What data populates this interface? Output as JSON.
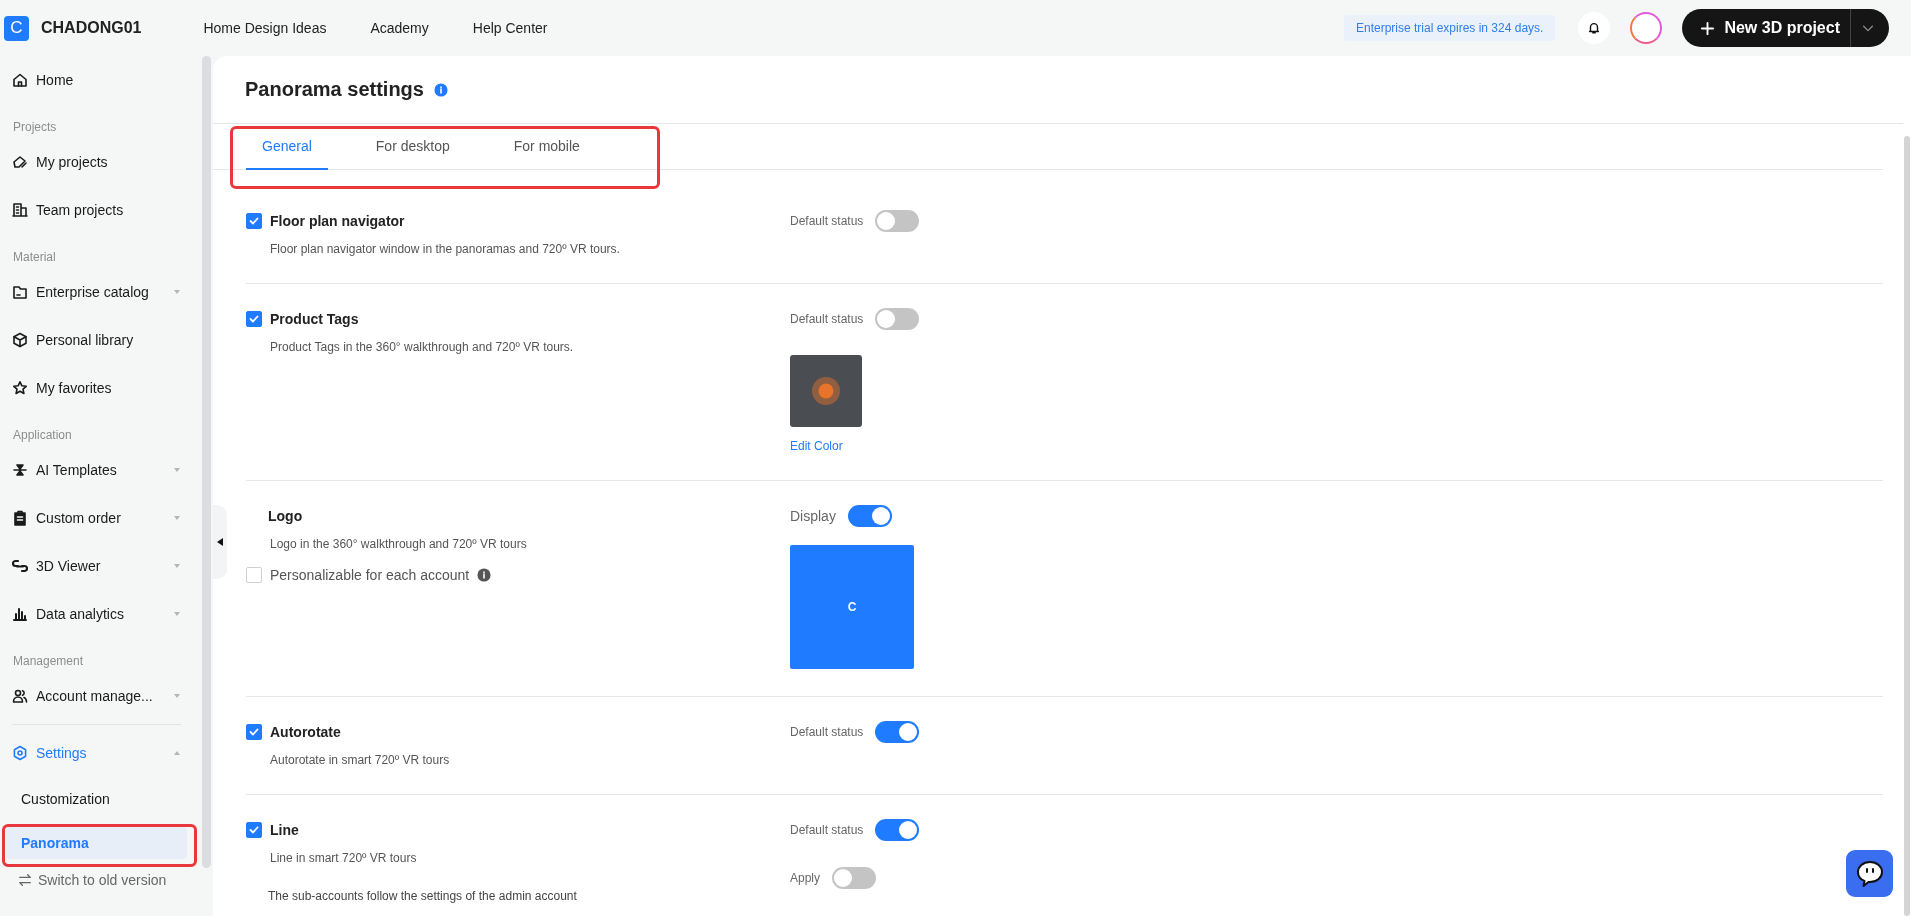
{
  "app": {
    "logo_letter": "C",
    "name": "CHADONG01"
  },
  "top_nav": [
    "Home Design Ideas",
    "Academy",
    "Help Center"
  ],
  "trial_notice": "Enterprise trial expires in 324 days.",
  "new_project_button": "New 3D project",
  "sidebar": {
    "items": [
      {
        "kind": "item",
        "label": "Home",
        "selected": false
      },
      {
        "kind": "section",
        "label": "Projects"
      },
      {
        "kind": "item",
        "label": "My projects",
        "selected": false
      },
      {
        "kind": "item",
        "label": "Team projects",
        "selected": false
      },
      {
        "kind": "section",
        "label": "Material"
      },
      {
        "kind": "item",
        "label": "Enterprise catalog",
        "selected": false,
        "expanded": false
      },
      {
        "kind": "item",
        "label": "Personal library",
        "selected": false
      },
      {
        "kind": "item",
        "label": "My favorites",
        "selected": false
      },
      {
        "kind": "section",
        "label": "Application"
      },
      {
        "kind": "item",
        "label": "AI Templates",
        "selected": false,
        "expanded": false
      },
      {
        "kind": "item",
        "label": "Custom order",
        "selected": false,
        "expanded": false
      },
      {
        "kind": "item",
        "label": "3D Viewer",
        "selected": false,
        "expanded": false
      },
      {
        "kind": "item",
        "label": "Data analytics",
        "selected": false,
        "expanded": false
      },
      {
        "kind": "section",
        "label": "Management"
      },
      {
        "kind": "item",
        "label": "Account manage...",
        "selected": false,
        "expanded": false
      },
      {
        "kind": "divider"
      },
      {
        "kind": "item",
        "label": "Settings",
        "selected": true,
        "expanded": true,
        "children": [
          {
            "label": "Customization",
            "selected": false,
            "annotated": false
          },
          {
            "label": "Panorama",
            "selected": true,
            "annotated": true
          }
        ]
      }
    ],
    "footer_link": "Switch to old version"
  },
  "page": {
    "title": "Panorama settings",
    "tabs": [
      {
        "label": "General",
        "selected": true
      },
      {
        "label": "For desktop",
        "selected": false
      },
      {
        "label": "For mobile",
        "selected": false
      }
    ],
    "tabs_annotated": true,
    "settings": [
      {
        "kind": "toggle",
        "checked": true,
        "title": "Floor plan navigator",
        "description": "Floor plan navigator window in the panoramas and 720º VR tours.",
        "status_label": "Default status",
        "on": false
      },
      {
        "kind": "tag",
        "checked": true,
        "title": "Product Tags",
        "description": "Product Tags in the 360° walkthrough and 720º VR tours.",
        "status_label": "Default status",
        "on": false,
        "edit_link": "Edit Color"
      },
      {
        "kind": "logo",
        "title": "Logo",
        "description": "Logo in the 360° walkthrough and 720º VR tours",
        "option": {
          "label": "Personalizable for each account",
          "checked": false
        },
        "status_label": "Display",
        "on": true,
        "logo_letter": "C"
      },
      {
        "kind": "toggle",
        "checked": true,
        "title": "Autorotate",
        "description": "Autorotate in smart 720º VR tours",
        "status_label": "Default status",
        "on": true
      },
      {
        "kind": "line",
        "checked": true,
        "title": "Line",
        "description": "Line in smart 720º VR tours",
        "status_label": "Default status",
        "on": true,
        "sub_note": "The sub-accounts follow the settings of the admin account",
        "apply_label": "Apply",
        "apply_on": false
      }
    ]
  }
}
